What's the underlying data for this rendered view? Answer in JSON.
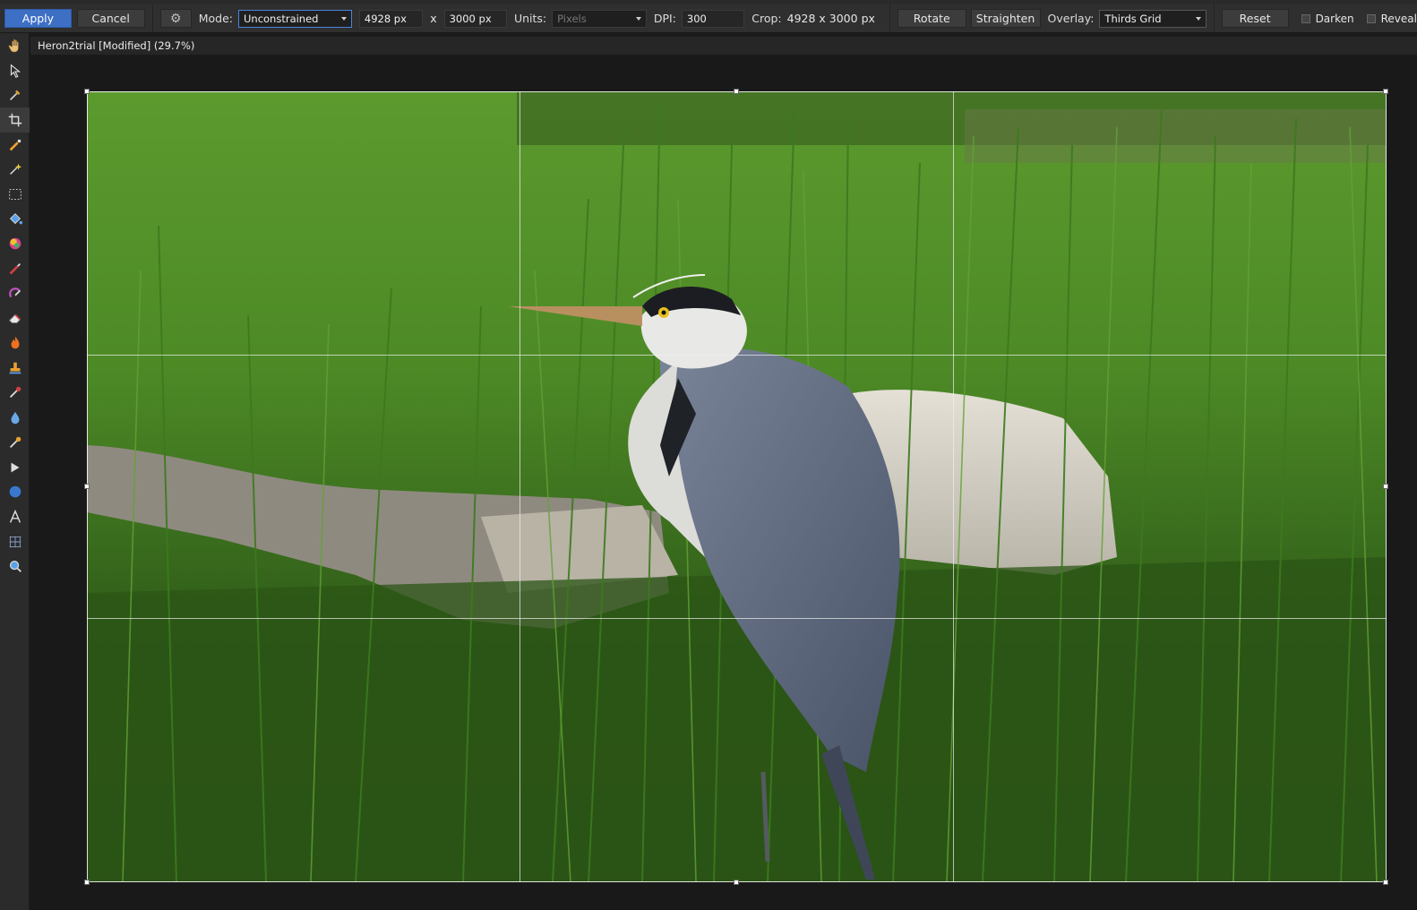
{
  "toolbar": {
    "apply_label": "Apply",
    "cancel_label": "Cancel",
    "mode_label": "Mode:",
    "mode_value": "Unconstrained",
    "width_value": "4928 px",
    "times_label": "x",
    "height_value": "3000 px",
    "units_label": "Units:",
    "units_value": "Pixels",
    "dpi_label": "DPI:",
    "dpi_value": "300",
    "crop_label": "Crop:",
    "crop_value": "4928 x 3000 px",
    "rotate_label": "Rotate",
    "straighten_label": "Straighten",
    "overlay_label": "Overlay:",
    "overlay_value": "Thirds Grid",
    "reset_label": "Reset",
    "darken_label": "Darken",
    "reveal_label": "Reveal"
  },
  "document": {
    "tab_title": "Heron2trial [Modified] (29.7%)"
  },
  "tools": [
    "view-tool-icon",
    "move-tool-icon",
    "color-picker-icon",
    "crop-tool-icon",
    "selection-brush-icon",
    "flood-select-icon",
    "marquee-select-icon",
    "fill-tool-icon",
    "gradient-tool-icon",
    "paint-brush-icon",
    "color-replacement-icon",
    "erase-brush-icon",
    "dodge-burn-icon",
    "clone-stamp-icon",
    "healing-brush-icon",
    "blur-tool-icon",
    "smudge-tool-icon",
    "pen-tool-icon",
    "shape-tool-icon",
    "text-tool-icon",
    "mesh-warp-icon",
    "zoom-tool-icon"
  ],
  "colors": {
    "accent": "#3d6fc5",
    "panel": "#2f2f2f",
    "canvas": "#191919"
  }
}
